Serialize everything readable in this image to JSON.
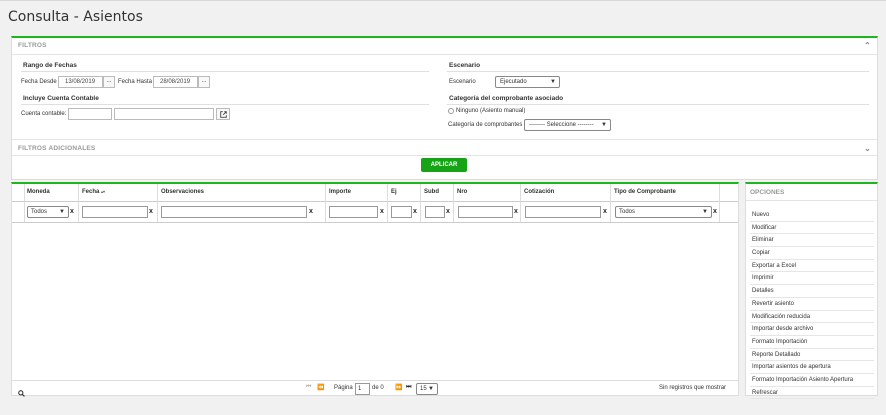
{
  "page": {
    "title": "Consulta - Asientos"
  },
  "filters": {
    "header": "FILTROS",
    "date_range": {
      "title": "Rango de Fechas",
      "from_label": "Fecha Desde",
      "from_value": "13/08/2019",
      "to_label": "Fecha Hasta",
      "to_value": "28/08/2019",
      "dots": "..."
    },
    "account": {
      "title": "Incluye Cuenta Contable",
      "label": "Cuenta contable:",
      "code_value": "",
      "name_value": ""
    },
    "scenario": {
      "title": "Escenario",
      "label": "Escenario",
      "value": "Ejecutado"
    },
    "voucher": {
      "title": "Categoría del comprobante asociado",
      "radio_label": "Ninguno (Asiento manual)",
      "category_label": "Categoría de comprobantes",
      "category_value": "-------- Seleccione --------"
    },
    "additional_header": "FILTROS ADICIONALES",
    "apply_label": "APLICAR"
  },
  "grid": {
    "columns": [
      "Moneda",
      "Fecha",
      "Observaciones",
      "Importe",
      "Ej",
      "Subd",
      "Nro",
      "Cotización",
      "Tipo de Comprobante"
    ],
    "sort_indicator": "▴▾",
    "filter_moneda": "Todos",
    "filter_tipo": "Todos",
    "clear_symbol": "x",
    "pager": {
      "page_label": "Página",
      "page_value": "1",
      "of_label": "de 0",
      "page_size": "15",
      "empty_message": "Sin registros que mostrar"
    }
  },
  "options": {
    "title": "OPCIONES",
    "items": [
      "Nuevo",
      "Modificar",
      "Eliminar",
      "Copiar",
      "Exportar a Excel",
      "Imprimir",
      "Detalles",
      "Revertir asiento",
      "Modificación reducida",
      "Importar desde archivo",
      "Formato Importación",
      "Reporte Detallado",
      "Importar asientos de apertura",
      "Formato Importación Asiento Apertura",
      "Refrescar"
    ]
  },
  "colors": {
    "accent": "#1fb51f",
    "apply_button": "#16a316",
    "background": "#f1f1f1"
  }
}
